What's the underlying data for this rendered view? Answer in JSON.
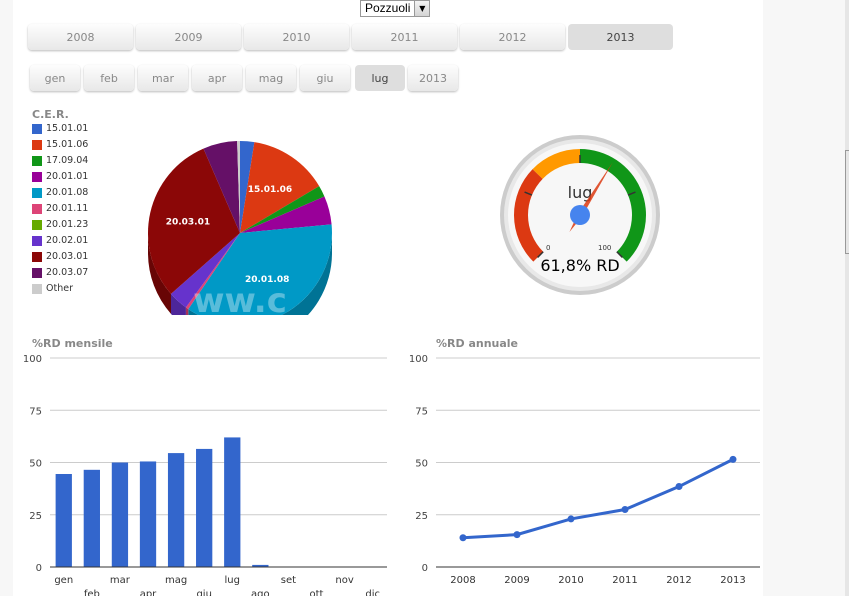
{
  "city_select": {
    "value": "Pozzuoli",
    "arrow": "chevron-down"
  },
  "years": [
    {
      "label": "2008",
      "active": false
    },
    {
      "label": "2009",
      "active": false
    },
    {
      "label": "2010",
      "active": false
    },
    {
      "label": "2011",
      "active": false
    },
    {
      "label": "2012",
      "active": false
    },
    {
      "label": "2013",
      "active": true
    }
  ],
  "months": [
    {
      "label": "gen",
      "active": false
    },
    {
      "label": "feb",
      "active": false
    },
    {
      "label": "mar",
      "active": false
    },
    {
      "label": "apr",
      "active": false
    },
    {
      "label": "mag",
      "active": false
    },
    {
      "label": "giu",
      "active": false
    },
    {
      "label": "lug",
      "active": true
    },
    {
      "label": "2013",
      "active": false
    }
  ],
  "pie": {
    "legend_title": "C.E.R.",
    "legend": [
      {
        "label": "15.01.01",
        "color": "#3366cc"
      },
      {
        "label": "15.01.06",
        "color": "#dc3912"
      },
      {
        "label": "17.09.04",
        "color": "#109618"
      },
      {
        "label": "20.01.01",
        "color": "#990099"
      },
      {
        "label": "20.01.08",
        "color": "#0099c6"
      },
      {
        "label": "20.01.11",
        "color": "#dd4477"
      },
      {
        "label": "20.01.23",
        "color": "#66aa00"
      },
      {
        "label": "20.02.01",
        "color": "#6633cc"
      },
      {
        "label": "20.03.01",
        "color": "#8b0707"
      },
      {
        "label": "20.03.07",
        "color": "#651067"
      },
      {
        "label": "Other",
        "color": "#cccccc"
      }
    ],
    "watermark": "ww.c"
  },
  "chart_data": [
    {
      "type": "pie",
      "title": "C.E.R.",
      "legend_position": "left",
      "slices": [
        {
          "label": "15.01.01",
          "value": 2.5
        },
        {
          "label": "15.01.06",
          "value": 14
        },
        {
          "label": "17.09.04",
          "value": 2
        },
        {
          "label": "20.01.01",
          "value": 5
        },
        {
          "label": "20.01.08",
          "value": 36
        },
        {
          "label": "20.01.11",
          "value": 0.5
        },
        {
          "label": "20.01.23",
          "value": 0
        },
        {
          "label": "20.02.01",
          "value": 3.5
        },
        {
          "label": "20.03.01",
          "value": 30
        },
        {
          "label": "20.03.07",
          "value": 6
        },
        {
          "label": "Other",
          "value": 0.5
        }
      ],
      "slice_labels_shown": [
        "15.01.06",
        "20.01.08",
        "20.03.01"
      ]
    },
    {
      "type": "gauge",
      "label": "lug",
      "value": 61.8,
      "min": 0,
      "max": 100,
      "min_label": "0",
      "max_label": "100",
      "readout": "61,8% RD",
      "bands": [
        {
          "from": 0,
          "to": 33,
          "color": "#dc3912"
        },
        {
          "from": 33,
          "to": 50,
          "color": "#ff9900"
        },
        {
          "from": 50,
          "to": 100,
          "color": "#109618"
        }
      ]
    },
    {
      "type": "bar",
      "title": "%RD mensile",
      "categories": [
        "gen",
        "feb",
        "mar",
        "apr",
        "mag",
        "giu",
        "lug",
        "ago",
        "set",
        "ott",
        "nov",
        "dic"
      ],
      "values": [
        44.5,
        46.5,
        50,
        50.5,
        54.5,
        56.5,
        62,
        1,
        0,
        0,
        0,
        0
      ],
      "ylim": [
        0,
        100
      ],
      "yticks": [
        "0",
        "25",
        "50",
        "75",
        "100"
      ],
      "color": "#3366cc",
      "grid": true
    },
    {
      "type": "line",
      "title": "%RD annuale",
      "categories": [
        "2008",
        "2009",
        "2010",
        "2011",
        "2012",
        "2013"
      ],
      "values": [
        14,
        15.5,
        23,
        27.5,
        38.5,
        51.5
      ],
      "ylim": [
        0,
        100
      ],
      "yticks": [
        "0",
        "25",
        "50",
        "75",
        "100"
      ],
      "color": "#3366cc",
      "grid": true
    }
  ]
}
